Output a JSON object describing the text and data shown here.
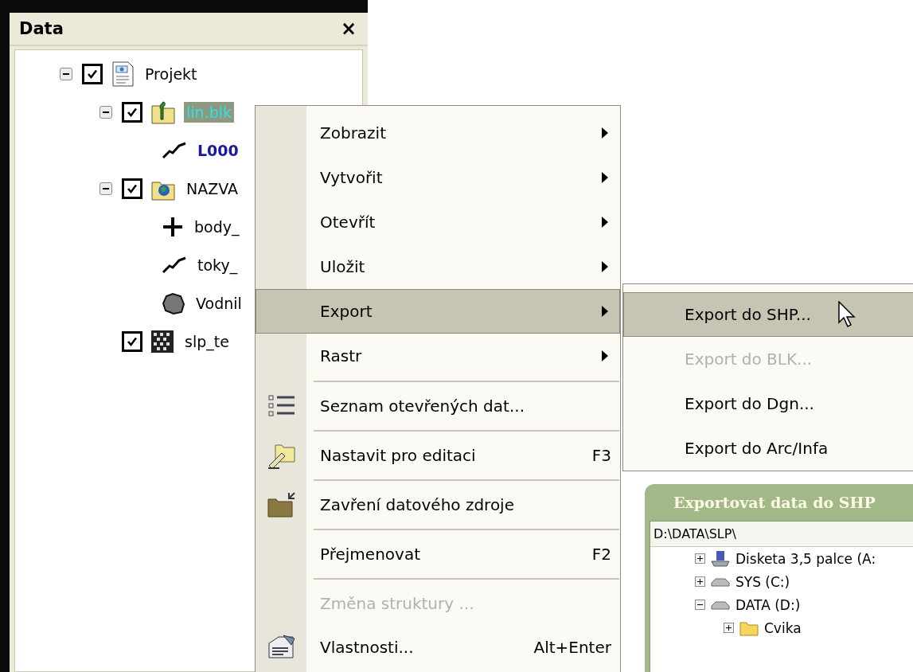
{
  "panel": {
    "title": "Data",
    "close": "×"
  },
  "tree": [
    {
      "label": "Projekt",
      "kind": "project",
      "checked": true,
      "expanded": true,
      "selected": false,
      "bold": false,
      "children": [
        {
          "label": "lin.blk",
          "kind": "layer",
          "checked": true,
          "expanded": true,
          "selected": true,
          "bold": false,
          "children": [
            {
              "label": "L000",
              "kind": "lines",
              "selected": false,
              "bold": true
            }
          ]
        },
        {
          "label": "NAZVA",
          "kind": "map",
          "checked": true,
          "expanded": true,
          "selected": false,
          "bold": false,
          "children": [
            {
              "label": "body_",
              "kind": "points",
              "selected": false,
              "bold": false
            },
            {
              "label": "toky_",
              "kind": "lines",
              "selected": false,
              "bold": false
            },
            {
              "label": "Vodnil",
              "kind": "polygon",
              "selected": false,
              "bold": false
            }
          ]
        },
        {
          "label": "slp_te",
          "kind": "raster",
          "checked": true,
          "selected": false,
          "bold": false
        }
      ]
    }
  ],
  "context_menu": [
    {
      "label": "Zobrazit",
      "submenu": true,
      "selected": false,
      "disabled": false,
      "separator_above": false
    },
    {
      "label": "Vytvořit",
      "submenu": true,
      "selected": false,
      "disabled": false,
      "separator_above": false
    },
    {
      "label": "Otevřít",
      "submenu": true,
      "selected": false,
      "disabled": false,
      "separator_above": false
    },
    {
      "label": "Uložit",
      "submenu": true,
      "selected": false,
      "disabled": false,
      "separator_above": false
    },
    {
      "label": "Export",
      "submenu": true,
      "selected": true,
      "disabled": false,
      "separator_above": false
    },
    {
      "label": "Rastr",
      "submenu": true,
      "selected": false,
      "disabled": false,
      "separator_above": false
    },
    {
      "label": "Seznam otevřených dat...",
      "submenu": false,
      "selected": false,
      "disabled": false,
      "separator_above": true
    },
    {
      "label": "Nastavit pro editaci",
      "shortcut": "F3",
      "submenu": false,
      "selected": false,
      "disabled": false,
      "separator_above": true
    },
    {
      "label": "Zavření datového zdroje",
      "submenu": false,
      "selected": false,
      "disabled": false,
      "separator_above": true
    },
    {
      "label": "Přejmenovat",
      "shortcut": "F2",
      "submenu": false,
      "selected": false,
      "disabled": false,
      "separator_above": true
    },
    {
      "label": "Změna struktury ...",
      "submenu": false,
      "selected": false,
      "disabled": true,
      "separator_above": true
    },
    {
      "label": "Vlastnosti...",
      "shortcut": "Alt+Enter",
      "submenu": false,
      "selected": false,
      "disabled": false,
      "separator_above": false
    }
  ],
  "export_submenu": [
    {
      "label": "Export do SHP...",
      "selected": true,
      "disabled": false
    },
    {
      "label": "Export do BLK...",
      "selected": false,
      "disabled": true
    },
    {
      "label": "Export do Dgn...",
      "selected": false,
      "disabled": false
    },
    {
      "label": "Export do Arc/Infa",
      "selected": false,
      "disabled": false
    }
  ],
  "dialog": {
    "title": "Exportovat data do SHP",
    "path": "D:\\DATA\\SLP\\",
    "tree": [
      {
        "label": "Disketa 3,5 palce (A:",
        "kind": "floppy",
        "expanded": false
      },
      {
        "label": "SYS (C:)",
        "kind": "drive",
        "expanded": false
      },
      {
        "label": "DATA (D:)",
        "kind": "drive",
        "expanded": true,
        "children": [
          {
            "label": "Cvika",
            "kind": "folder",
            "expanded": false
          }
        ]
      }
    ]
  }
}
